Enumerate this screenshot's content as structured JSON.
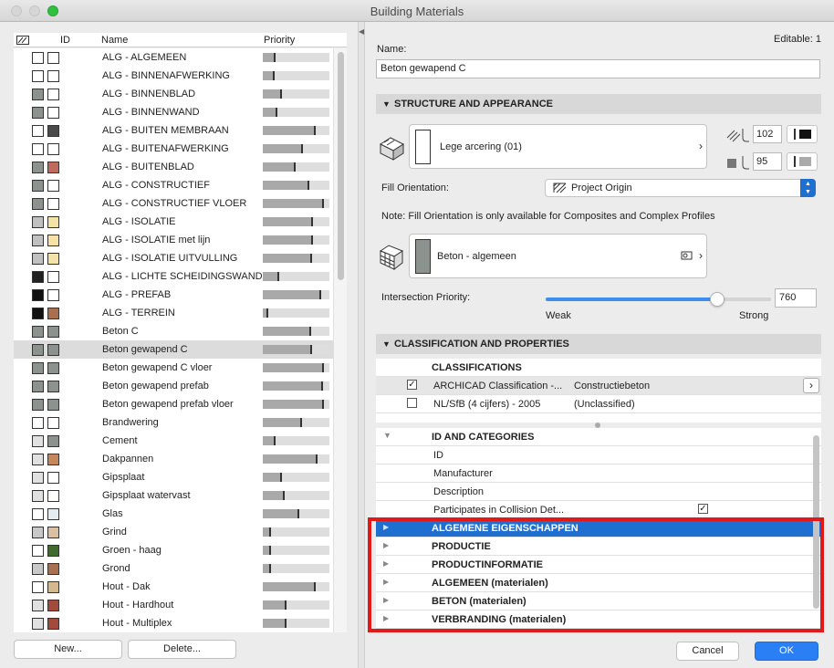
{
  "window": {
    "title": "Building Materials"
  },
  "list": {
    "headers": {
      "id": "ID",
      "name": "Name",
      "priority": "Priority"
    },
    "items": [
      {
        "name": "ALG - ALGEMEEN",
        "c1": "#ffffff",
        "c2": "#ffffff",
        "p": 0.2
      },
      {
        "name": "ALG - BINNENAFWERKING",
        "c1": "#ffffff",
        "c2": "#ffffff",
        "p": 0.18
      },
      {
        "name": "ALG - BINNENBLAD",
        "c1": "#8c928d",
        "c2": "#ffffff",
        "p": 0.3
      },
      {
        "name": "ALG - BINNENWAND",
        "c1": "#8c928d",
        "c2": "#ffffff",
        "p": 0.22
      },
      {
        "name": "ALG - BUITEN MEMBRAAN",
        "c1": "#ffffff",
        "c2": "#4a4a4a",
        "p": 0.82
      },
      {
        "name": "ALG - BUITENAFWERKING",
        "c1": "#ffffff",
        "c2": "#ffffff",
        "p": 0.62
      },
      {
        "name": "ALG - BUITENBLAD",
        "c1": "#8c928d",
        "c2": "#c06a5e",
        "p": 0.5
      },
      {
        "name": "ALG - CONSTRUCTIEF",
        "c1": "#8c928d",
        "c2": "#ffffff",
        "p": 0.72
      },
      {
        "name": "ALG - CONSTRUCTIEF VLOER",
        "c1": "#8c928d",
        "c2": "#ffffff",
        "p": 0.95
      },
      {
        "name": "ALG - ISOLATIE",
        "c1": "#c0c0c0",
        "c2": "#f4e2a6",
        "p": 0.78
      },
      {
        "name": "ALG - ISOLATIE met lijn",
        "c1": "#c0c0c0",
        "c2": "#f4e2a6",
        "p": 0.78
      },
      {
        "name": "ALG - ISOLATIE UITVULLING",
        "c1": "#c0c0c0",
        "c2": "#f4e2a6",
        "p": 0.76
      },
      {
        "name": "ALG - LICHTE SCHEIDINGSWAND",
        "c1": "#222222",
        "c2": "#ffffff",
        "p": 0.26
      },
      {
        "name": "ALG - PREFAB",
        "c1": "#111111",
        "c2": "#ffffff",
        "p": 0.9
      },
      {
        "name": "ALG - TERREIN",
        "c1": "#111111",
        "c2": "#a8704f",
        "p": 0.08
      },
      {
        "name": "Beton C",
        "c1": "#8c928d",
        "c2": "#8c928d",
        "p": 0.75
      },
      {
        "name": "Beton gewapend C",
        "c1": "#8c928d",
        "c2": "#8c928d",
        "p": 0.76,
        "selected": true
      },
      {
        "name": "Beton gewapend C vloer",
        "c1": "#8c928d",
        "c2": "#8c928d",
        "p": 0.95
      },
      {
        "name": "Beton gewapend prefab",
        "c1": "#8c928d",
        "c2": "#8c928d",
        "p": 0.93
      },
      {
        "name": "Beton gewapend prefab vloer",
        "c1": "#8c928d",
        "c2": "#8c928d",
        "p": 0.95
      },
      {
        "name": "Brandwering",
        "c1": "#ffffff",
        "c2": "#ffffff",
        "p": 0.6
      },
      {
        "name": "Cement",
        "c1": "#e0e0e0",
        "c2": "#8c928d",
        "p": 0.2
      },
      {
        "name": "Dakpannen",
        "c1": "#e0e0e0",
        "c2": "#c4885c",
        "p": 0.84
      },
      {
        "name": "Gipsplaat",
        "c1": "#e0e0e0",
        "c2": "#ffffff",
        "p": 0.3
      },
      {
        "name": "Gipsplaat watervast",
        "c1": "#e0e0e0",
        "c2": "#ffffff",
        "p": 0.34
      },
      {
        "name": "Glas",
        "c1": "#ffffff",
        "c2": "#e4eef2",
        "p": 0.56
      },
      {
        "name": "Grind",
        "c1": "#c8c8c8",
        "c2": "#d9c0a2",
        "p": 0.12
      },
      {
        "name": "Groen - haag",
        "c1": "#ffffff",
        "c2": "#3f6b2e",
        "p": 0.12
      },
      {
        "name": "Grond",
        "c1": "#c8c8c8",
        "c2": "#a8704f",
        "p": 0.12
      },
      {
        "name": "Hout - Dak",
        "c1": "#ffffff",
        "c2": "#d6b88e",
        "p": 0.82
      },
      {
        "name": "Hout - Hardhout",
        "c1": "#e0e0e0",
        "c2": "#a24a3c",
        "p": 0.36
      },
      {
        "name": "Hout - Multiplex",
        "c1": "#e0e0e0",
        "c2": "#a24a3c",
        "p": 0.36
      }
    ],
    "new_label": "New...",
    "delete_label": "Delete..."
  },
  "editor": {
    "editable": "Editable: 1",
    "name_label": "Name:",
    "name_value": "Beton gewapend C",
    "structure_title": "STRUCTURE AND APPEARANCE",
    "fill_name": "Lege arcering (01)",
    "pen1": "102",
    "pen2": "95",
    "fill_orientation_label": "Fill Orientation:",
    "fill_orientation_value": "Project Origin",
    "note": "Note: Fill Orientation is only available for Composites and Complex Profiles",
    "surface_name": "Beton - algemeen",
    "surface_color": "#8c928d",
    "intersection_label": "Intersection Priority:",
    "intersection_value": "760",
    "intersection_fraction": 0.76,
    "weak": "Weak",
    "strong": "Strong",
    "classification_title": "CLASSIFICATION AND PROPERTIES",
    "cls_header": "CLASSIFICATIONS",
    "cls_rows": [
      {
        "checked": true,
        "system": "ARCHICAD Classification -...",
        "value": "Constructiebeton"
      },
      {
        "checked": false,
        "system": "NL/SfB (4 cijfers) - 2005",
        "value": "(Unclassified)"
      }
    ],
    "props": {
      "id_cat": "ID AND CATEGORIES",
      "id": "ID",
      "manufacturer": "Manufacturer",
      "description": "Description",
      "collision": "Participates in Collision Det...",
      "groups": [
        "ALGEMENE EIGENSCHAPPEN",
        "PRODUCTIE",
        "PRODUCTINFORMATIE",
        "ALGEMEEN (materialen)",
        "BETON (materialen)",
        "VERBRANDING (materialen)"
      ]
    },
    "cancel_label": "Cancel",
    "ok_label": "OK"
  },
  "colors": {
    "accent": "#1f6fd1",
    "highlight": "#e01919"
  }
}
